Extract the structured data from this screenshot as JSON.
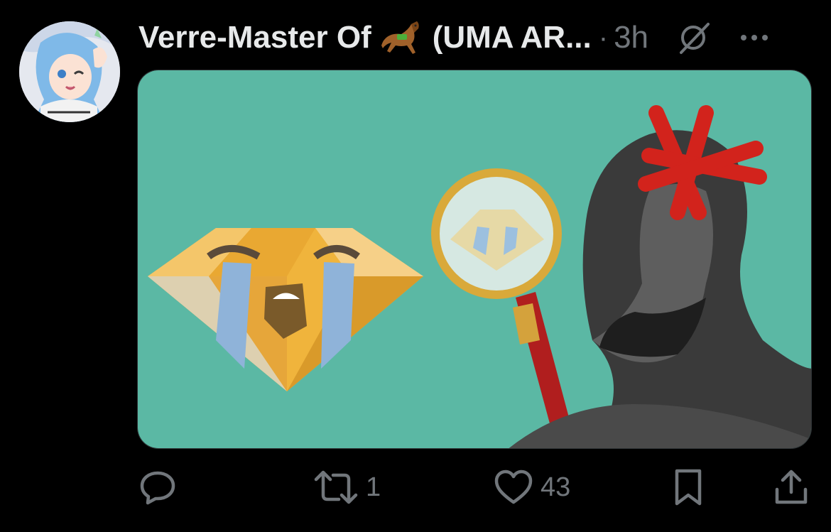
{
  "post": {
    "author_name": "Verre-Master Of",
    "author_name_suffix": "(UMA AR...",
    "author_emoji": "racehorse-icon",
    "separator": "·",
    "time": "3h",
    "grok_icon": "grok-icon",
    "more_icon": "more-icon",
    "media_alt": "crying-diamond-magnifying-glass-meme"
  },
  "actions": {
    "reply": {
      "icon": "reply-icon",
      "count": ""
    },
    "repost": {
      "icon": "repost-icon",
      "count": "1"
    },
    "like": {
      "icon": "heart-icon",
      "count": "43"
    },
    "bookmark": {
      "icon": "bookmark-icon"
    },
    "share": {
      "icon": "share-icon"
    }
  },
  "colors": {
    "background": "#000000",
    "text_primary": "#e7e9ea",
    "text_secondary": "#71767b",
    "media_background": "#5bb8a4",
    "diamond_gold": "#f0b43c",
    "tears_blue": "#8fb3d9",
    "mark_red": "#d2231c"
  }
}
